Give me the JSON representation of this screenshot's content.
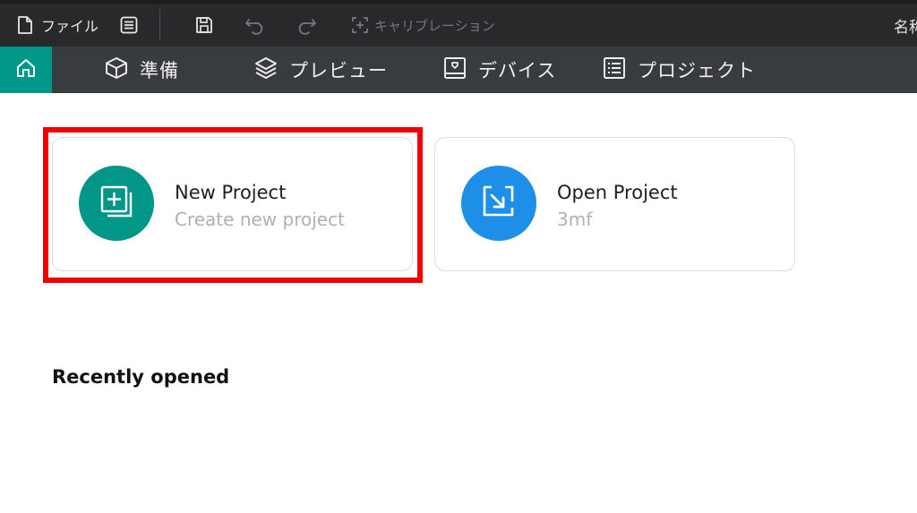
{
  "menubar": {
    "file_label": "ファイル",
    "calibration_label": "キャリブレーション",
    "title_text": "名称"
  },
  "tabs": [
    {
      "label": "準備",
      "icon": "cube-icon"
    },
    {
      "label": "プレビュー",
      "icon": "layers-icon"
    },
    {
      "label": "デバイス",
      "icon": "device-icon"
    },
    {
      "label": "プロジェクト",
      "icon": "list-icon"
    }
  ],
  "cards": {
    "new_project": {
      "title": "New Project",
      "subtitle": "Create new project",
      "color": "#009688"
    },
    "open_project": {
      "title": "Open Project",
      "subtitle": "3mf",
      "color": "#1e8fe8"
    }
  },
  "recent": {
    "heading": "Recently opened"
  },
  "colors": {
    "accent": "#009688",
    "highlight": "#f20000"
  }
}
